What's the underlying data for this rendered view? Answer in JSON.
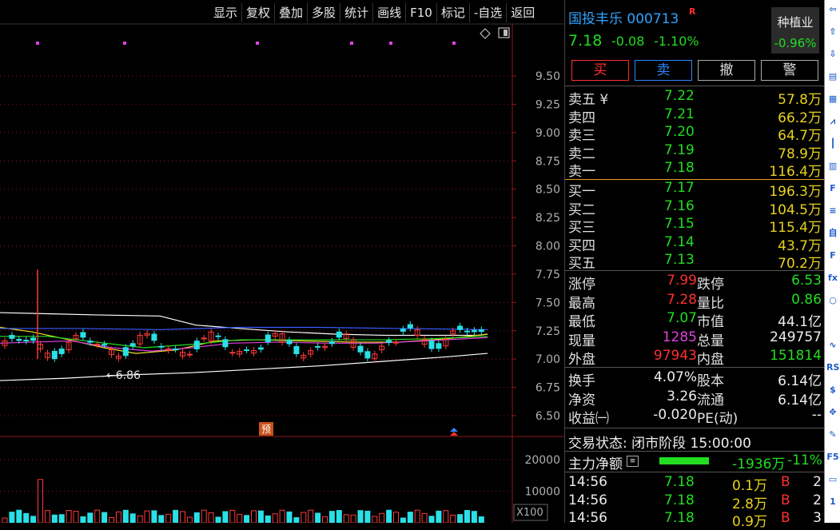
{
  "toolbar": {
    "items": [
      "显示",
      "复权",
      "叠加",
      "多股",
      "统计",
      "画线",
      "F10",
      "标记",
      "-自选",
      "返回"
    ]
  },
  "chart": {
    "price_axis": [
      "9.50",
      "9.25",
      "9.00",
      "8.75",
      "8.50",
      "8.25",
      "8.00",
      "7.75",
      "7.50",
      "7.25",
      "7.00",
      "6.75",
      "6.50"
    ],
    "low_marker": "←6.86",
    "yu_badge": "预",
    "volume_axis": [
      "20000",
      "10000"
    ],
    "volume_scale": "X100",
    "colors": {
      "up": "#ff3a3a",
      "down": "#29e0e6",
      "ma1": "#ffffff",
      "ma2": "#f0e020",
      "ma3": "#e040e0",
      "ma4": "#22dd22",
      "ma5": "#3a5cff",
      "grid": "#8b1a1a",
      "signal": "#e040e0"
    }
  },
  "chart_data": {
    "type": "candlestick",
    "price_range": [
      6.45,
      9.75
    ],
    "volume_range": [
      0,
      25000
    ],
    "price_ticks": [
      9.5,
      9.25,
      9.0,
      8.75,
      8.5,
      8.25,
      8.0,
      7.75,
      7.5,
      7.25,
      7.0,
      6.75,
      6.5
    ],
    "volume_ticks": [
      20000,
      10000
    ],
    "low_annotation": 6.86
  },
  "quote": {
    "name": "国投丰乐",
    "code": "000713",
    "r_badge": "R",
    "price": "7.18",
    "change": "-0.08",
    "change_pct": "-1.10%",
    "industry": "种植业",
    "industry_pct": "-0.96%",
    "actions": {
      "buy": "买",
      "sell": "卖",
      "cancel": "撤",
      "alert": "警"
    },
    "sell_levels": [
      {
        "label": "卖五 ¥",
        "price": "7.22",
        "vol": "57.8万"
      },
      {
        "label": "卖四",
        "price": "7.21",
        "vol": "66.2万"
      },
      {
        "label": "卖三",
        "price": "7.20",
        "vol": "64.7万"
      },
      {
        "label": "卖二",
        "price": "7.19",
        "vol": "78.9万"
      },
      {
        "label": "卖一",
        "price": "7.18",
        "vol": "116.4万"
      }
    ],
    "buy_levels": [
      {
        "label": "买一",
        "price": "7.17",
        "vol": "196.3万"
      },
      {
        "label": "买二",
        "price": "7.16",
        "vol": "104.5万"
      },
      {
        "label": "买三",
        "price": "7.15",
        "vol": "115.4万"
      },
      {
        "label": "买四",
        "price": "7.14",
        "vol": "43.7万"
      },
      {
        "label": "买五",
        "price": "7.13",
        "vol": "70.2万"
      }
    ],
    "stats": [
      {
        "l1": "涨停",
        "v1": "7.99",
        "l2": "跌停",
        "v2": "6.53"
      },
      {
        "l1": "最高",
        "v1": "7.28",
        "l2": "量比",
        "v2": "0.86"
      },
      {
        "l1": "最低",
        "v1": "7.07",
        "l2": "市值",
        "v2": "44.1亿"
      },
      {
        "l1": "现量",
        "v1": "1285",
        "l2": "总量",
        "v2": "249757"
      },
      {
        "l1": "外盘",
        "v1": "97943",
        "l2": "内盘",
        "v2": "151814"
      }
    ],
    "fundamentals": [
      {
        "l1": "换手",
        "v1": "4.07%",
        "l2": "股本",
        "v2": "6.14亿"
      },
      {
        "l1": "净资",
        "v1": "3.26",
        "l2": "流通",
        "v2": "6.14亿"
      },
      {
        "l1": "收益㈠",
        "v1": "-0.020",
        "l2": "PE(动)",
        "v2": "--"
      }
    ],
    "status": "交易状态: 闭市阶段 15:00:00",
    "main_flow_label": "主力净额",
    "main_flow_value": "-1936万",
    "main_flow_pct": "-11%",
    "ticks": [
      {
        "time": "14:56",
        "price": "7.18",
        "vol": "0.1万",
        "side": "B",
        "n": "2"
      },
      {
        "time": "14:56",
        "price": "7.18",
        "vol": "2.8万",
        "side": "B",
        "n": "2"
      },
      {
        "time": "14:56",
        "price": "7.18",
        "vol": "0.9万",
        "side": "B",
        "n": "3"
      }
    ]
  },
  "sidebar": {
    "icons": [
      "back-icon",
      "up-arrow-icon",
      "down-arrow-icon",
      "list-icon",
      "table-icon",
      "line-chart-icon",
      "candle-chart-icon",
      "grid-icon",
      "f10-icon",
      "news-icon",
      "self-select-icon",
      "formula-icon",
      "fx-icon",
      "search-icon",
      "blank-icon",
      "wave-icon",
      "rss-icon",
      "dollar-icon",
      "move-icon",
      "pencil-icon",
      "f5-icon",
      "window-icon",
      "one-icon"
    ],
    "labels": [
      "⇦",
      "⇧",
      "⇩",
      "▤",
      "▦",
      "⩘",
      "┃",
      "▥",
      "F",
      "≡",
      "自",
      "F",
      "fx",
      "○",
      "",
      "∿",
      "RS",
      "$",
      "✥",
      "✎",
      "F5",
      "▭",
      "1"
    ]
  }
}
